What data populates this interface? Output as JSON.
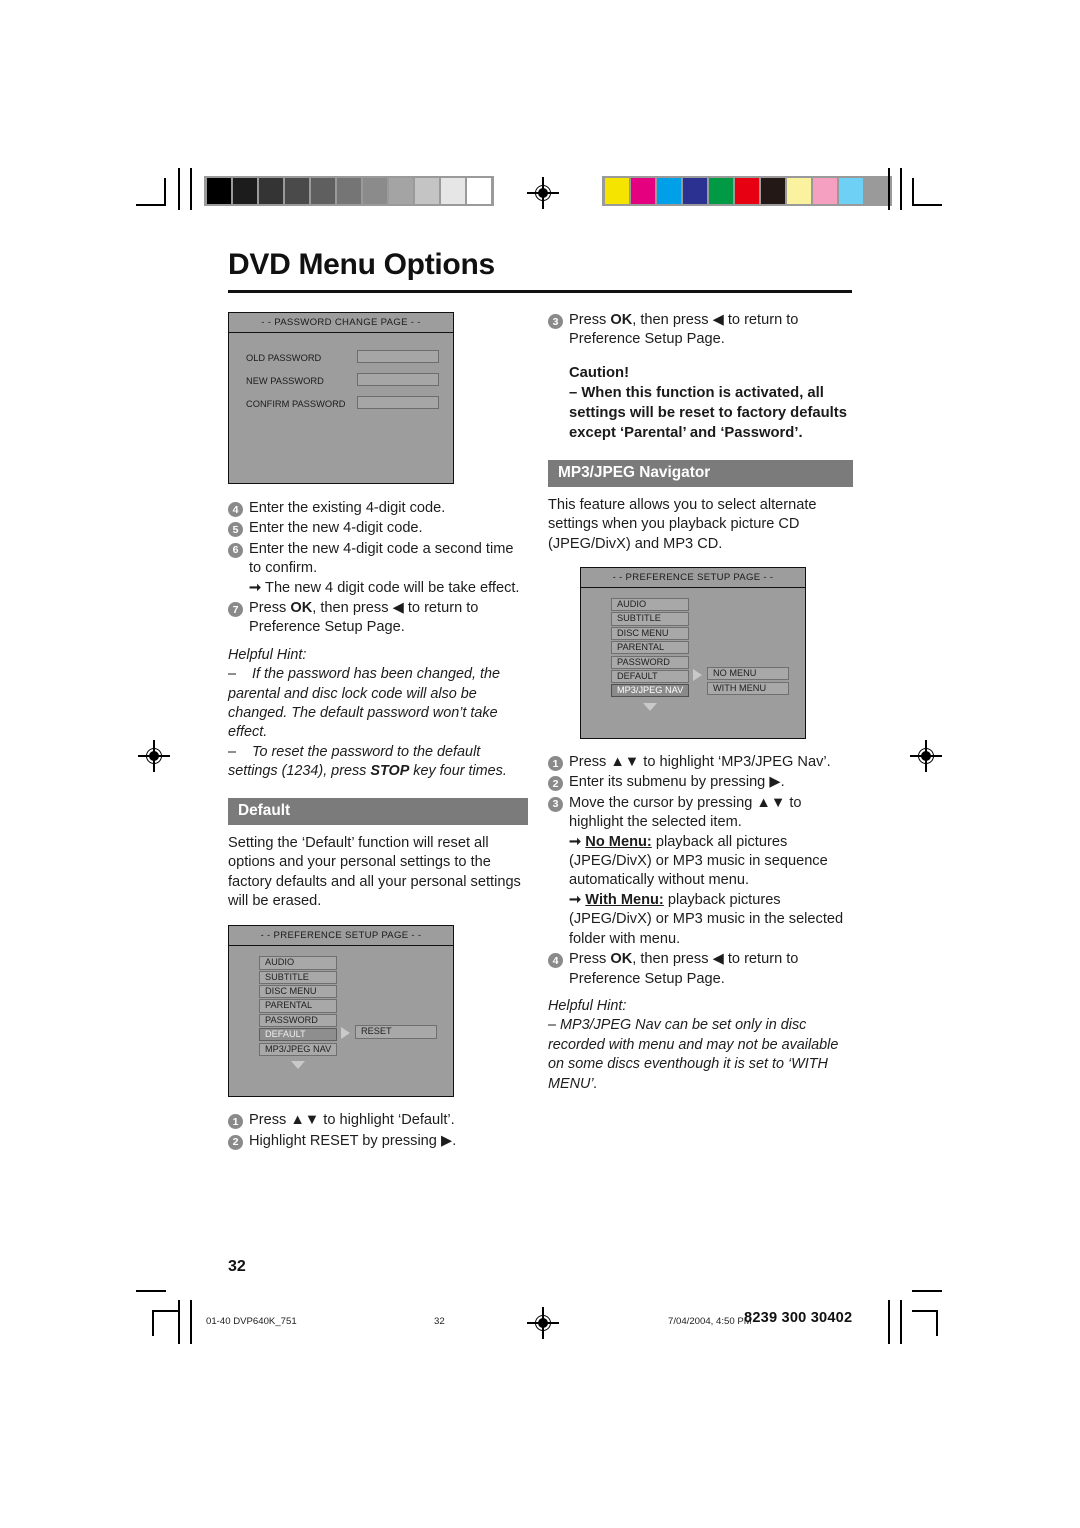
{
  "header": {
    "title": "DVD Menu Options",
    "grayscale_swatches": [
      "#000000",
      "#1c1c1c",
      "#343434",
      "#4a4a4a",
      "#5f5f5f",
      "#757575",
      "#8b8b8b",
      "#a4a4a4",
      "#c4c4c4",
      "#e6e6e6",
      "#ffffff"
    ],
    "color_swatches": [
      "#f5e400",
      "#e4007f",
      "#00a0e9",
      "#2b3190",
      "#009944",
      "#e60012",
      "#231815",
      "#fbf2a0",
      "#f5a0c0",
      "#6fd0f5",
      "#9a9a9a"
    ]
  },
  "password_screen": {
    "title": "- - PASSWORD CHANGE PAGE - -",
    "fields": [
      "OLD PASSWORD",
      "NEW PASSWORD",
      "CONFIRM PASSWORD"
    ]
  },
  "left_column": {
    "steps": [
      {
        "num": "4",
        "text": "Enter the existing 4-digit code."
      },
      {
        "num": "5",
        "text": "Enter the new 4-digit code."
      },
      {
        "num": "6",
        "text": "Enter the new 4-digit code a second time to confirm."
      },
      {
        "num": "7",
        "text": "Press OK, then press ◀ to return to Preference Setup Page."
      }
    ],
    "step6_bullet": "The new 4 digit code will be take effect.",
    "step7_pre": "Press ",
    "step7_ok": "OK",
    "step7_mid": ", then press ",
    "step7_arrow": "◀",
    "step7_post": " to return to Preference Setup Page.",
    "hint_label": "Helpful Hint:",
    "hint_1": "If the password has been changed, the parental and disc lock code will also be changed. The default password won’t take effect.",
    "hint_2_pre": "To reset the password to the default settings (1234), press ",
    "hint_2_bold": "STOP",
    "hint_2_post": " key four times."
  },
  "default_section": {
    "band_label": "Default",
    "body": "Setting the ‘Default’ function will reset all options and your personal settings to the factory defaults and all your personal settings will be erased.",
    "steps": [
      {
        "num": "1",
        "pre": "Press ",
        "keys": "▲▼",
        "post": " to highlight ‘Default’."
      },
      {
        "num": "2",
        "pre": "Highlight RESET by pressing ",
        "keys": "▶",
        "post": "."
      }
    ]
  },
  "default_screen": {
    "title": "- - PREFERENCE SETUP PAGE - -",
    "menu_items": [
      "AUDIO",
      "SUBTITLE",
      "DISC MENU",
      "PARENTAL",
      "PASSWORD",
      "DEFAULT",
      "MP3/JPEG NAV"
    ],
    "selected_item": "DEFAULT",
    "submenu_items": [
      "RESET"
    ]
  },
  "right_column": {
    "step3": {
      "num": "3",
      "pre": "Press ",
      "ok": "OK",
      "mid": ", then press ",
      "arrow": "◀",
      "post": " to return to Preference Setup Page."
    },
    "caution_label": "Caution!",
    "caution_text": "–  When this function is activated, all settings will be reset to factory defaults except ‘Parental’ and ‘Password’."
  },
  "mp3_section": {
    "band_label": "MP3/JPEG Navigator",
    "intro": "This feature allows you to select alternate settings when you playback picture CD (JPEG/DivX) and MP3 CD.",
    "steps": [
      {
        "num": "1",
        "pre": "Press ",
        "keys": "▲▼",
        "post": " to highlight ‘MP3/JPEG Nav’."
      },
      {
        "num": "2",
        "pre": "Enter its submenu by pressing ",
        "keys": "▶",
        "post": "."
      },
      {
        "num": "3",
        "pre": "Move the cursor by pressing ",
        "keys": "▲▼",
        "post": " to highlight the selected item."
      }
    ],
    "bullet_no_menu_label": "No Menu:",
    "bullet_no_menu_text": " playback all pictures (JPEG/DivX) or MP3 music in sequence automatically without menu.",
    "bullet_with_menu_label": "With Menu:",
    "bullet_with_menu_text": " playback pictures (JPEG/DivX) or MP3 music in the selected folder with menu.",
    "step4": {
      "num": "4",
      "pre": "Press ",
      "ok": "OK",
      "mid": ", then press ",
      "arrow": "◀",
      "post": " to return to Preference Setup Page."
    },
    "hint_label": "Helpful Hint:",
    "hint_text": "–    MP3/JPEG Nav can be set only in disc recorded with menu and may not be available on some discs eventhough it is set to ‘WITH MENU’."
  },
  "mp3_screen": {
    "title": "- - PREFERENCE SETUP PAGE - -",
    "menu_items": [
      "AUDIO",
      "SUBTITLE",
      "DISC MENU",
      "PARENTAL",
      "PASSWORD",
      "DEFAULT",
      "MP3/JPEG NAV"
    ],
    "selected_item": "MP3/JPEG NAV",
    "submenu_items": [
      "NO MENU",
      "WITH MENU"
    ]
  },
  "footer": {
    "page_number": "32",
    "file_name": "01-40 DVP640K_751",
    "foot_page": "32",
    "timestamp": "7/04/2004, 4:50 PM",
    "doc_code": "8239 300 30402"
  }
}
